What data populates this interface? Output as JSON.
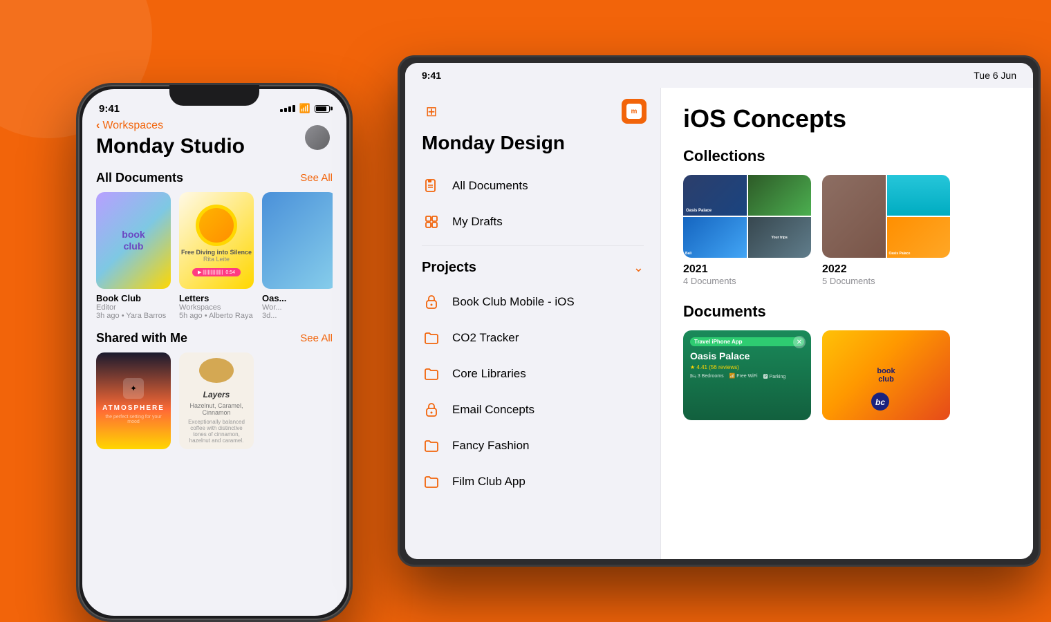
{
  "background": {
    "color": "#F2640A"
  },
  "iphone": {
    "time": "9:41",
    "back_label": "Workspaces",
    "workspace_title": "Monday Studio",
    "all_documents_label": "All Documents",
    "see_all_label": "See All",
    "shared_label": "Shared with Me",
    "see_all2_label": "See All",
    "cards": [
      {
        "name": "Book Club",
        "sub1": "Editor",
        "sub2": "3h ago • Yara Barros"
      },
      {
        "name": "Letters",
        "sub1": "Workspaces",
        "sub2": "5h ago • Alberto Raya"
      },
      {
        "name": "Oas...",
        "sub1": "Wor...",
        "sub2": "3d..."
      }
    ],
    "shared_cards": [
      {
        "name": "Atmosphere"
      },
      {
        "name": "Layers",
        "sub1": "Hazelnut, Caramel, Cinnamon",
        "sub2": "Exceptionally balanced coffee with distinctive tones of cinnamon, hazelnut and caramel."
      }
    ]
  },
  "ipad": {
    "time": "9:41",
    "date": "Tue 6 Jun",
    "workspace_title": "Monday Design",
    "nav_items": [
      {
        "label": "All Documents",
        "icon": "document"
      },
      {
        "label": "My Drafts",
        "icon": "grid"
      }
    ],
    "projects_label": "Projects",
    "project_items": [
      {
        "label": "Book Club Mobile - iOS",
        "icon": "lock"
      },
      {
        "label": "CO2 Tracker",
        "icon": "folder"
      },
      {
        "label": "Core Libraries",
        "icon": "folder"
      },
      {
        "label": "Email Concepts",
        "icon": "lock"
      },
      {
        "label": "Fancy Fashion",
        "icon": "folder"
      },
      {
        "label": "Film Club App",
        "icon": "folder"
      }
    ],
    "main": {
      "page_title": "iOS Concepts",
      "collections_label": "Collections",
      "collections": [
        {
          "year": "2021",
          "count": "4 Documents"
        },
        {
          "year": "2022",
          "count": "5 Documents"
        }
      ],
      "documents_label": "Documents",
      "documents": [
        {
          "name": "Travel iPhone App Oasis Palace"
        },
        {
          "name": "Book Club"
        }
      ]
    }
  }
}
